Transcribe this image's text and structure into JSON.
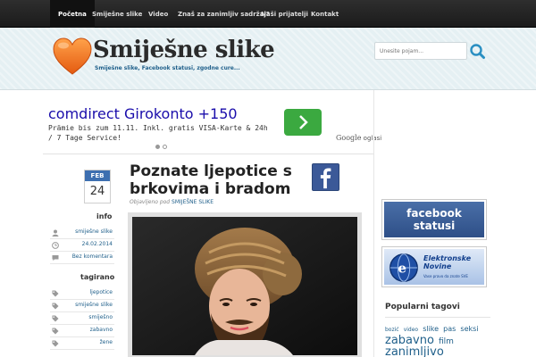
{
  "nav": {
    "items": [
      {
        "label": "Početna",
        "active": true
      },
      {
        "label": "Smiješne slike"
      },
      {
        "label": "Video"
      },
      {
        "label": "Znaš za zanimljiv sadržaj?"
      },
      {
        "label": "Naši prijatelji"
      },
      {
        "label": "Kontakt"
      }
    ]
  },
  "header": {
    "title": "Smiješne slike",
    "subtitle": "Smiješne slike, Facebook statusi, zgodne cure...",
    "logo_icon": "heart-icon",
    "search_placeholder": "Unesite pojam..."
  },
  "ad": {
    "title": "comdirect Girokonto +150",
    "text": "Prämie bis zum 11.11. Inkl. gratis VISA-Karte & 24h / 7 Tage Service!",
    "brand": "Google",
    "brand_suffix": "oglasi",
    "button_color": "#3ba940"
  },
  "post": {
    "month": "FEB",
    "day": "24",
    "title": "Poznate ljepotice s brkovima i bradom",
    "byline_prefix": "Objavljeno pod",
    "byline_category": "SMIJEŠNE SLIKE",
    "info_heading": "info",
    "info": [
      {
        "icon": "user-icon",
        "text": "smiješne slike"
      },
      {
        "icon": "clock-icon",
        "text": "24.02.2014"
      },
      {
        "icon": "comment-icon",
        "text": "Bez komentara"
      }
    ],
    "tags_heading": "tagirano",
    "tags": [
      "ljepotice",
      "smiješne slike",
      "smiješno",
      "zabavno",
      "žene"
    ]
  },
  "sidebar": {
    "banner1": "facebook statusi",
    "banner1_line1": "facebook",
    "banner1_line2": "statusi",
    "banner2_line1": "Elektronske",
    "banner2_line2": "Novine",
    "banner2_sub": "Vase pravo da znate SVE",
    "popular_heading": "Popularni tagovi",
    "tag_cloud": [
      {
        "text": "bozić",
        "size": 6
      },
      {
        "text": "video",
        "size": 6
      },
      {
        "text": "slike",
        "size": 8
      },
      {
        "text": "pas",
        "size": 8
      },
      {
        "text": "seksi",
        "size": 8
      },
      {
        "text": "zabavno",
        "size": 13
      },
      {
        "text": "film",
        "size": 9
      },
      {
        "text": "zanimljivo",
        "size": 13
      }
    ]
  },
  "colors": {
    "nav_bg": "#1b1b1b",
    "header_bg": "#e5f0f3",
    "link": "#1f5f8a",
    "date_month_bg": "#3d6fb0",
    "facebook": "#3b5998"
  }
}
